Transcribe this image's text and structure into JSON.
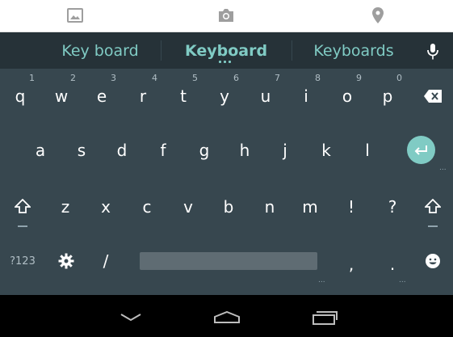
{
  "attach_bar": {
    "icons": [
      "image-icon",
      "camera-icon",
      "location-pin-icon"
    ],
    "color": "#9e9e9e"
  },
  "suggestions": {
    "left": "Key board",
    "center": "Keyboard",
    "right": "Keyboards",
    "color": "#80cbc4"
  },
  "keyboard": {
    "row1": [
      {
        "key": "q",
        "hint": "1"
      },
      {
        "key": "w",
        "hint": "2"
      },
      {
        "key": "e",
        "hint": "3"
      },
      {
        "key": "r",
        "hint": "4"
      },
      {
        "key": "t",
        "hint": "5"
      },
      {
        "key": "y",
        "hint": "6"
      },
      {
        "key": "u",
        "hint": "7"
      },
      {
        "key": "i",
        "hint": "8"
      },
      {
        "key": "o",
        "hint": "9"
      },
      {
        "key": "p",
        "hint": "0"
      }
    ],
    "row2": [
      "a",
      "s",
      "d",
      "f",
      "g",
      "h",
      "j",
      "k",
      "l"
    ],
    "row3": [
      "z",
      "x",
      "c",
      "v",
      "b",
      "n",
      "m",
      "!",
      "?"
    ],
    "row4": {
      "symbols": "?123",
      "slash": "/",
      "comma": ",",
      "period": "."
    },
    "accent": "#80cbc4",
    "background": "#37474f"
  },
  "nav": {
    "icons": [
      "back-chevron-icon",
      "home-icon",
      "recents-icon"
    ]
  }
}
